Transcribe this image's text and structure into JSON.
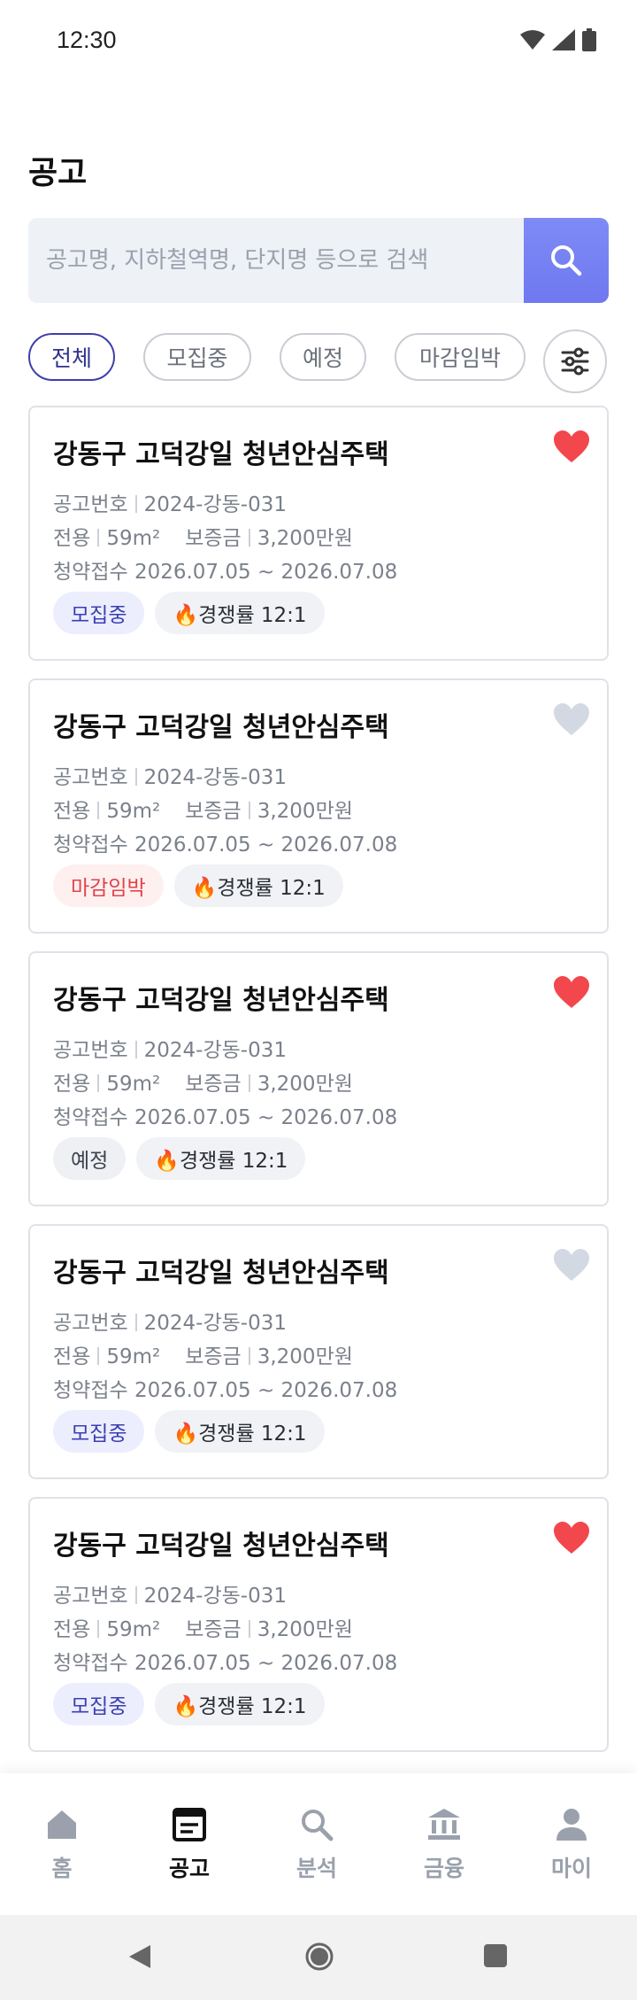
{
  "status_bar": {
    "time": "12:30"
  },
  "page": {
    "title": "공고"
  },
  "search": {
    "placeholder": "공고명, 지하철역명, 단지명 등으로 검색"
  },
  "filters": [
    {
      "label": "전체",
      "active": true
    },
    {
      "label": "모집중",
      "active": false
    },
    {
      "label": "예정",
      "active": false
    },
    {
      "label": "마감임박",
      "active": false
    }
  ],
  "listings": [
    {
      "title": "강동구 고덕강일 청년안심주택",
      "notice_label": "공고번호",
      "notice_no": "2024-강동-031",
      "area_label": "전용",
      "area": "59m²",
      "deposit_label": "보증금",
      "deposit": "3,200만원",
      "period_label": "청약접수",
      "period": "2026.07.05 ~ 2026.07.08",
      "status": "모집중",
      "competition": "🔥경쟁률  12:1",
      "favorited": true
    },
    {
      "title": "강동구 고덕강일 청년안심주택",
      "notice_label": "공고번호",
      "notice_no": "2024-강동-031",
      "area_label": "전용",
      "area": "59m²",
      "deposit_label": "보증금",
      "deposit": "3,200만원",
      "period_label": "청약접수",
      "period": "2026.07.05 ~ 2026.07.08",
      "status": "마감임박",
      "competition": "🔥경쟁률  12:1",
      "favorited": false
    },
    {
      "title": "강동구 고덕강일 청년안심주택",
      "notice_label": "공고번호",
      "notice_no": "2024-강동-031",
      "area_label": "전용",
      "area": "59m²",
      "deposit_label": "보증금",
      "deposit": "3,200만원",
      "period_label": "청약접수",
      "period": "2026.07.05 ~ 2026.07.08",
      "status": "예정",
      "competition": "🔥경쟁률  12:1",
      "favorited": true
    },
    {
      "title": "강동구 고덕강일 청년안심주택",
      "notice_label": "공고번호",
      "notice_no": "2024-강동-031",
      "area_label": "전용",
      "area": "59m²",
      "deposit_label": "보증금",
      "deposit": "3,200만원",
      "period_label": "청약접수",
      "period": "2026.07.05 ~ 2026.07.08",
      "status": "모집중",
      "competition": "🔥경쟁률  12:1",
      "favorited": false
    },
    {
      "title": "강동구 고덕강일 청년안심주택",
      "notice_label": "공고번호",
      "notice_no": "2024-강동-031",
      "area_label": "전용",
      "area": "59m²",
      "deposit_label": "보증금",
      "deposit": "3,200만원",
      "period_label": "청약접수",
      "period": "2026.07.05 ~ 2026.07.08",
      "status": "모집중",
      "competition": "🔥경쟁률  12:1",
      "favorited": true
    }
  ],
  "bottom_nav": [
    {
      "label": "홈",
      "icon": "home-icon",
      "active": false
    },
    {
      "label": "공고",
      "icon": "notice-icon",
      "active": true
    },
    {
      "label": "분석",
      "icon": "search-icon",
      "active": false
    },
    {
      "label": "금융",
      "icon": "bank-icon",
      "active": false
    },
    {
      "label": "마이",
      "icon": "person-icon",
      "active": false
    }
  ],
  "colors": {
    "accent": "#6f78f0",
    "active_chip": "#3d3fa8",
    "heart_on": "#f2474d",
    "heart_off": "#d3d9e2",
    "closing": "#e0434a"
  }
}
